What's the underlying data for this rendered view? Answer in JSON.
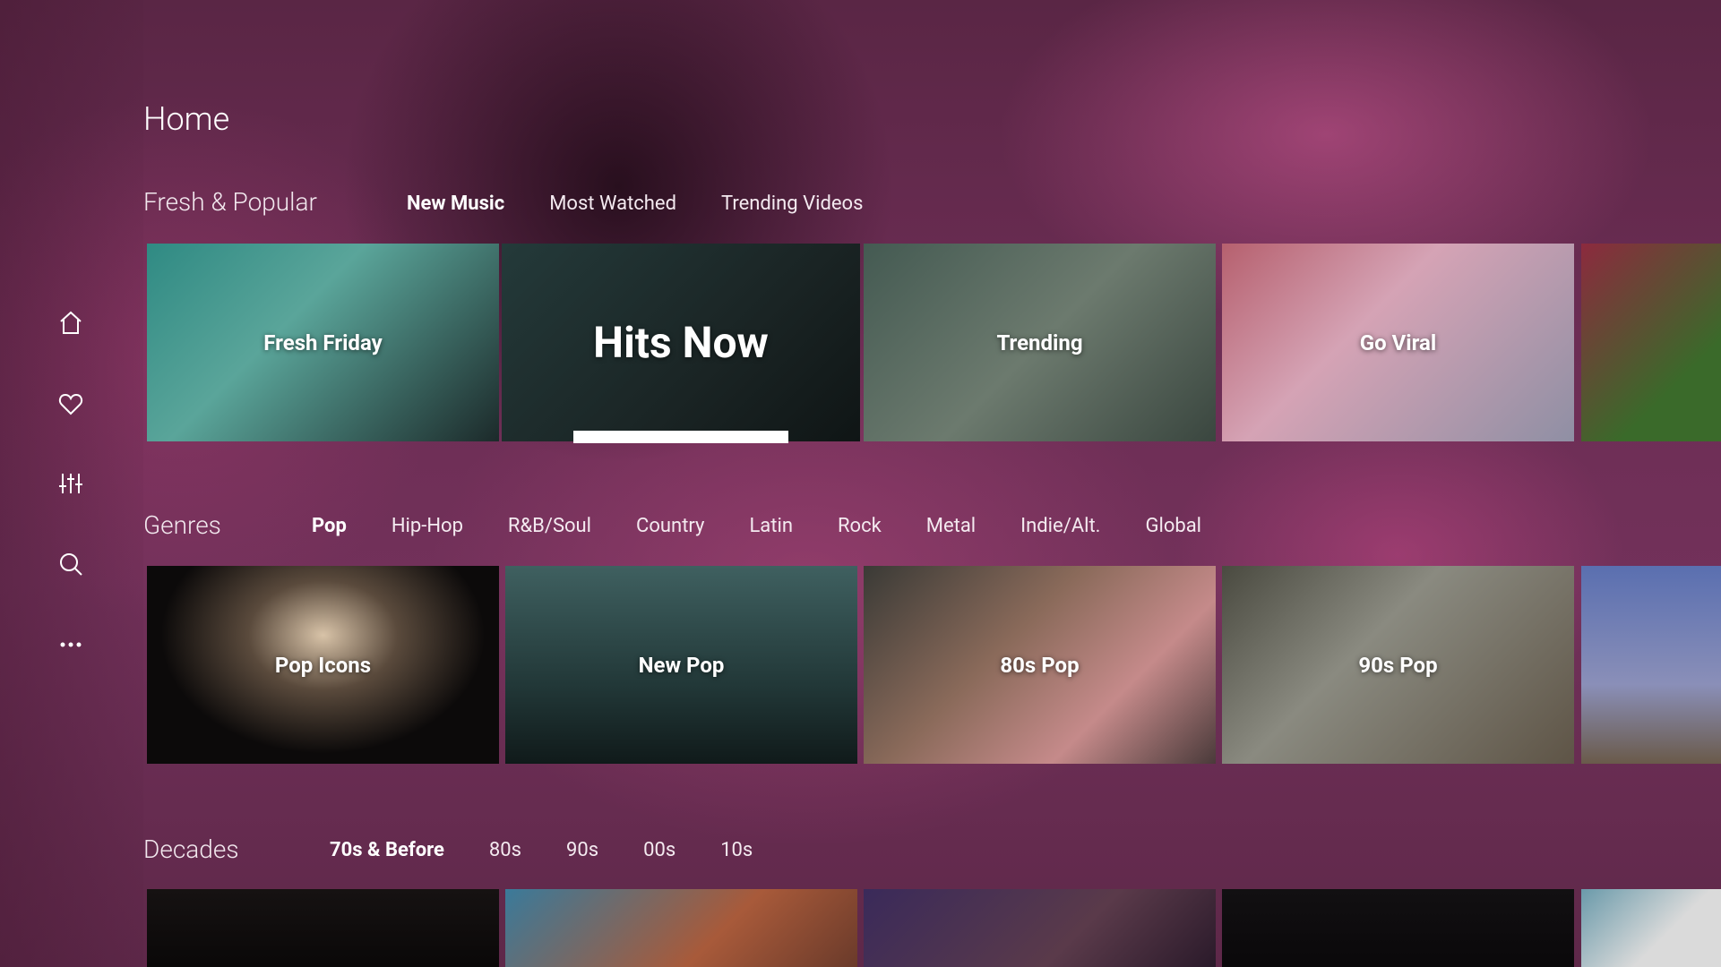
{
  "page": {
    "title": "Home"
  },
  "sidebar": {
    "items": [
      {
        "icon": "home-icon"
      },
      {
        "icon": "heart-icon"
      },
      {
        "icon": "sliders-icon"
      },
      {
        "icon": "search-icon"
      },
      {
        "icon": "more-icon"
      }
    ]
  },
  "fresh": {
    "title": "Fresh & Popular",
    "tabs": [
      "New Music",
      "Most Watched",
      "Trending Videos"
    ],
    "active_tab": "New Music",
    "cards": [
      "Fresh Friday",
      "Hits Now",
      "Trending",
      "Go Viral"
    ],
    "focused_card": "Hits Now"
  },
  "genres": {
    "title": "Genres",
    "tabs": [
      "Pop",
      "Hip-Hop",
      "R&B/Soul",
      "Country",
      "Latin",
      "Rock",
      "Metal",
      "Indie/Alt.",
      "Global"
    ],
    "active_tab": "Pop",
    "cards": [
      "Pop Icons",
      "New Pop",
      "80s Pop",
      "90s Pop"
    ]
  },
  "decades": {
    "title": "Decades",
    "tabs": [
      "70s & Before",
      "80s",
      "90s",
      "00s",
      "10s"
    ],
    "active_tab": "70s & Before"
  }
}
